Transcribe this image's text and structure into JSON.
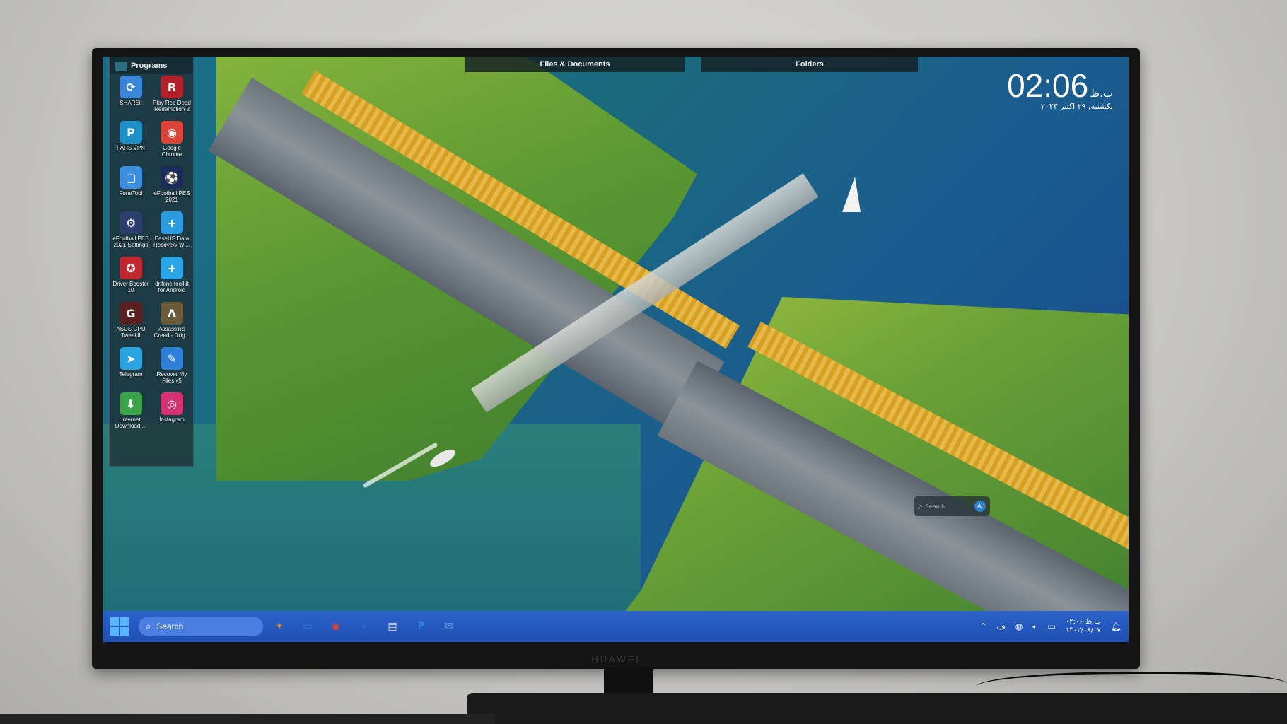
{
  "monitor": {
    "brand": "HUAWEI"
  },
  "fences": {
    "programs": {
      "title": "Programs",
      "items": [
        {
          "label": "SHAREit",
          "icon": "shareit-icon",
          "glyph": "⟳",
          "color": "#3a86d9"
        },
        {
          "label": "Play Red Dead Redemption 2",
          "icon": "red-dead-icon",
          "glyph": "R",
          "color": "#b3202a"
        },
        {
          "label": "PARS VPN",
          "icon": "pars-vpn-icon",
          "glyph": "P",
          "color": "#1e90c8"
        },
        {
          "label": "Google Chrome",
          "icon": "chrome-icon",
          "glyph": "◉",
          "color": "#db4437"
        },
        {
          "label": "FoneTool",
          "icon": "fonetool-icon",
          "glyph": "▢",
          "color": "#3b8ee0"
        },
        {
          "label": "eFootball PES 2021",
          "icon": "efootball-icon",
          "glyph": "⚽",
          "color": "#1c2c5a"
        },
        {
          "label": "eFootball PES 2021 Settings",
          "icon": "efootball-settings-icon",
          "glyph": "⚙",
          "color": "#2b3e6e"
        },
        {
          "label": "EaseUS Data Recovery Wi...",
          "icon": "easeus-icon",
          "glyph": "+",
          "color": "#2a9be0"
        },
        {
          "label": "Driver Booster 10",
          "icon": "driver-booster-icon",
          "glyph": "✪",
          "color": "#c0282e"
        },
        {
          "label": "dr.fone toolkit for Android",
          "icon": "drfone-icon",
          "glyph": "+",
          "color": "#2aa6e8"
        },
        {
          "label": "ASUS GPU TweakII",
          "icon": "asus-gpu-icon",
          "glyph": "G",
          "color": "#5a1f1f"
        },
        {
          "label": "Assassin's Creed - Orig...",
          "icon": "assassins-creed-icon",
          "glyph": "Λ",
          "color": "#6b5a3a"
        },
        {
          "label": "Telegram",
          "icon": "telegram-icon",
          "glyph": "➤",
          "color": "#2aa3e0"
        },
        {
          "label": "Recover My Files v5",
          "icon": "recover-files-icon",
          "glyph": "✎",
          "color": "#2d7fd8"
        },
        {
          "label": "Internet Download ...",
          "icon": "idm-icon",
          "glyph": "⬇",
          "color": "#3aa34a"
        },
        {
          "label": "Instagram",
          "icon": "instagram-icon",
          "glyph": "◎",
          "color": "#d6326f"
        }
      ]
    },
    "files_documents": {
      "title": "Files & Documents"
    },
    "folders": {
      "title": "Folders"
    }
  },
  "clock": {
    "time": "02:06",
    "ampm": "ب.ظ",
    "date": "یکشنبه, ۲۹ اکتبر ۲۰۲۳"
  },
  "search_widget": {
    "placeholder": "Search",
    "ai_label": "AI"
  },
  "taskbar": {
    "search_label": "Search",
    "apps": [
      {
        "icon": "copilot-icon",
        "glyph": "✦",
        "color": "#e98a2f"
      },
      {
        "icon": "desktop-icon",
        "glyph": "▭",
        "color": "#2b86d8"
      },
      {
        "icon": "chrome-icon",
        "glyph": "◉",
        "color": "#db4437"
      },
      {
        "icon": "search-tool-icon",
        "glyph": "⌕",
        "color": "#3f73cc"
      },
      {
        "icon": "document-icon",
        "glyph": "▤",
        "color": "#e7e7e7"
      },
      {
        "icon": "pars-app-icon",
        "glyph": "P",
        "color": "#2ca0e6"
      },
      {
        "icon": "mail-icon",
        "glyph": "✉",
        "color": "#5ea3e6"
      }
    ],
    "tray": {
      "time": "۰۲:۰۶ ب.ظ",
      "date": "۱۴۰۲/۰۸/۰۷"
    }
  }
}
